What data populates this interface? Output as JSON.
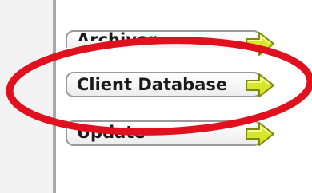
{
  "menu": {
    "items": [
      {
        "label": "Archiver"
      },
      {
        "label": "Client Database"
      },
      {
        "label": "Update"
      }
    ]
  },
  "icons": {
    "arrow": "arrow-right-icon"
  },
  "colors": {
    "highlight_ellipse": "#e0101f",
    "arrow_fill": "#d8e62a",
    "arrow_stroke": "#7a8a10",
    "pill_border": "#9a9a9a"
  }
}
